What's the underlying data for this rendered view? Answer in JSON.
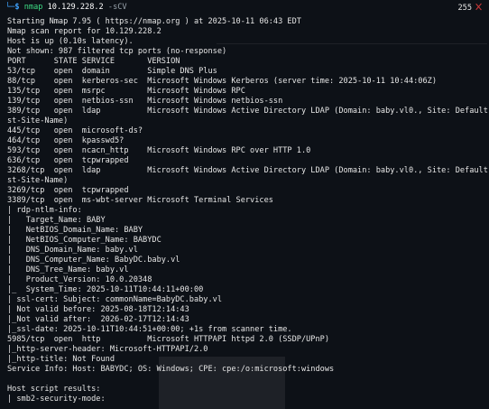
{
  "terminal": {
    "prompt_arrow": "└─",
    "prompt_symbol": "$",
    "command": "nmap",
    "target": "10.129.228.2",
    "flags": "-sCV",
    "exit_code": "255",
    "output_lines": [
      "Starting Nmap 7.95 ( https://nmap.org ) at 2025-10-11 06:43 EDT",
      "Nmap scan report for 10.129.228.2",
      "Host is up (0.10s latency).",
      "Not shown: 987 filtered tcp ports (no-response)",
      "PORT      STATE SERVICE       VERSION",
      "53/tcp    open  domain        Simple DNS Plus",
      "88/tcp    open  kerberos-sec  Microsoft Windows Kerberos (server time: 2025-10-11 10:44:06Z)",
      "135/tcp   open  msrpc         Microsoft Windows RPC",
      "139/tcp   open  netbios-ssn   Microsoft Windows netbios-ssn",
      "389/tcp   open  ldap          Microsoft Windows Active Directory LDAP (Domain: baby.vl0., Site: Default-Fir",
      "st-Site-Name)",
      "445/tcp   open  microsoft-ds?",
      "464/tcp   open  kpasswd5?",
      "593/tcp   open  ncacn_http    Microsoft Windows RPC over HTTP 1.0",
      "636/tcp   open  tcpwrapped",
      "3268/tcp  open  ldap          Microsoft Windows Active Directory LDAP (Domain: baby.vl0., Site: Default-Fir",
      "st-Site-Name)",
      "3269/tcp  open  tcpwrapped",
      "3389/tcp  open  ms-wbt-server Microsoft Terminal Services",
      "| rdp-ntlm-info:",
      "|   Target_Name: BABY",
      "|   NetBIOS_Domain_Name: BABY",
      "|   NetBIOS_Computer_Name: BABYDC",
      "|   DNS_Domain_Name: baby.vl",
      "|   DNS_Computer_Name: BabyDC.baby.vl",
      "|   DNS_Tree_Name: baby.vl",
      "|   Product_Version: 10.0.20348",
      "|_  System_Time: 2025-10-11T10:44:11+00:00",
      "| ssl-cert: Subject: commonName=BabyDC.baby.vl",
      "| Not valid before: 2025-08-18T12:14:43",
      "|_Not valid after:  2026-02-17T12:14:43",
      "|_ssl-date: 2025-10-11T10:44:51+00:00; +1s from scanner time.",
      "5985/tcp  open  http          Microsoft HTTPAPI httpd 2.0 (SSDP/UPnP)",
      "|_http-server-header: Microsoft-HTTPAPI/2.0",
      "|_http-title: Not Found",
      "Service Info: Host: BABYDC; OS: Windows; CPE: cpe:/o:microsoft:windows",
      "",
      "Host script results:",
      "| smb2-security-mode:"
    ]
  },
  "colors": {
    "background": "#0d1117",
    "prompt": "#3ea3ff",
    "command": "#3ddc84",
    "error_mark": "#d33a3a"
  },
  "icons": {
    "exit_status": "close-x-icon"
  }
}
